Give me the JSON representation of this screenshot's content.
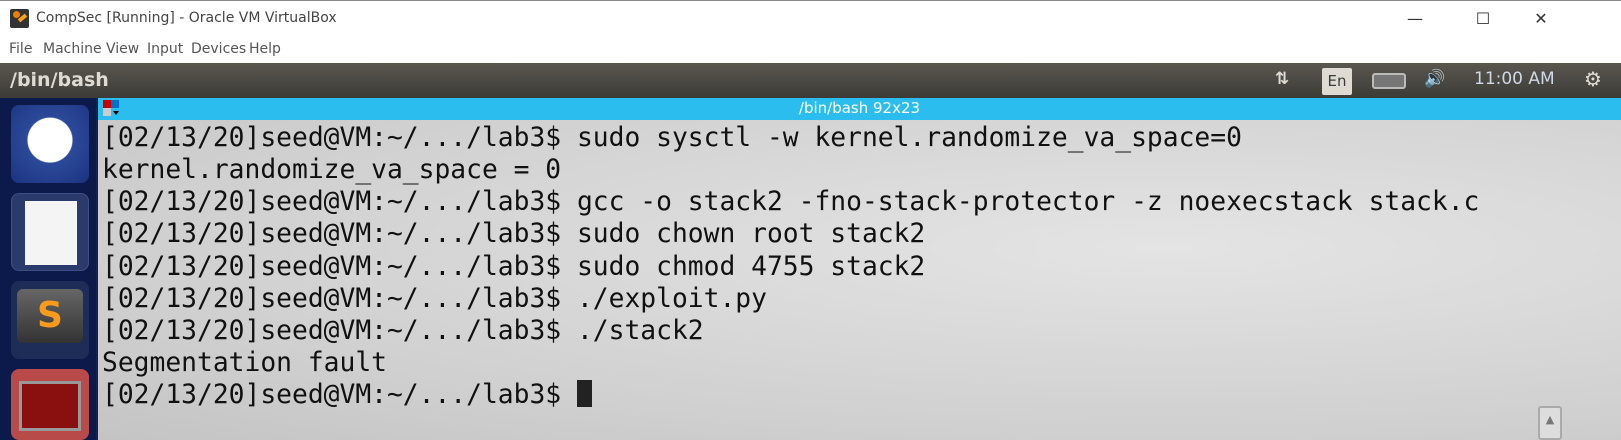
{
  "window": {
    "title": "CompSec [Running] - Oracle VM VirtualBox",
    "minimize": "—",
    "maximize": "☐",
    "close": "✕"
  },
  "menu": [
    "File",
    "Machine",
    "View",
    "Input",
    "Devices",
    "Help"
  ],
  "panel": {
    "title": "/bin/bash",
    "keyboard": "En",
    "clock": "11:00 AM",
    "network_icon": "⇅",
    "volume_icon": "🔊",
    "power_icon": "⚙"
  },
  "launcher": [
    "ubuntu-dash",
    "text-editor",
    "sublime-text",
    "terminal"
  ],
  "terminal": {
    "title": "/bin/bash 92x23",
    "lines": [
      "[02/13/20]seed@VM:~/.../lab3$ sudo sysctl -w kernel.randomize_va_space=0",
      "kernel.randomize_va_space = 0",
      "[02/13/20]seed@VM:~/.../lab3$ gcc -o stack2 -fno-stack-protector -z noexecstack stack.c",
      "[02/13/20]seed@VM:~/.../lab3$ sudo chown root stack2",
      "[02/13/20]seed@VM:~/.../lab3$ sudo chmod 4755 stack2",
      "[02/13/20]seed@VM:~/.../lab3$ ./exploit.py",
      "[02/13/20]seed@VM:~/.../lab3$ ./stack2",
      "Segmentation fault",
      "[02/13/20]seed@VM:~/.../lab3$ "
    ],
    "scroll_up": "▲"
  }
}
